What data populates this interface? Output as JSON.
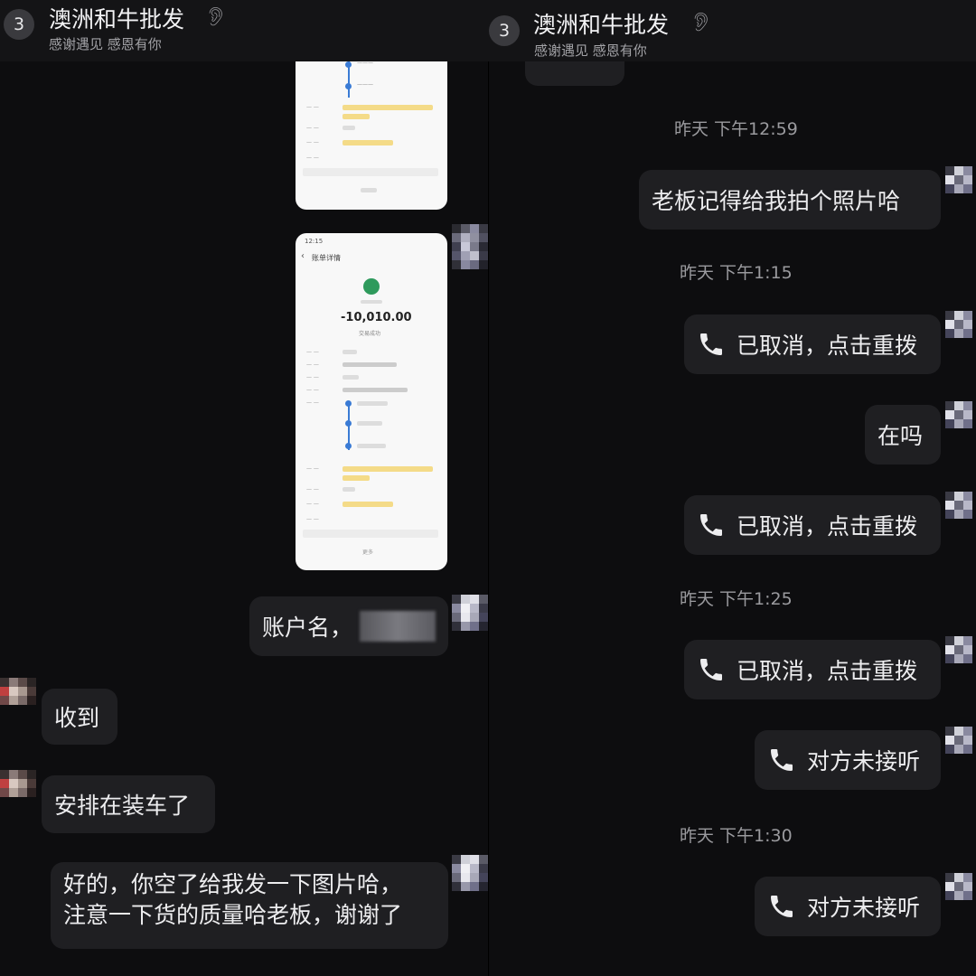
{
  "left_chat": {
    "header": {
      "unread": "3",
      "title": "澳洲和牛批发",
      "subtitle": "感谢遇见 感恩有你"
    },
    "receipt": {
      "status_time": "12:15",
      "page_title": "账单详情",
      "amount": "-10,010.00",
      "status": "交易成功",
      "footer": "更多"
    },
    "messages": {
      "account_name": "账户名，",
      "received": "收到",
      "loading": "安排在装车了",
      "request_line1": "好的，你空了给我发一下图片哈，",
      "request_line2": "注意一下货的质量哈老板，谢谢了"
    }
  },
  "right_chat": {
    "header": {
      "unread": "3",
      "title": "澳洲和牛批发",
      "subtitle": "感谢遇见 感恩有你"
    },
    "timestamps": [
      "昨天 下午12:59",
      "昨天 下午1:15",
      "昨天 下午1:25",
      "昨天 下午1:30"
    ],
    "messages": {
      "photo_request": "老板记得给我拍个照片哈",
      "cancelled_1": "已取消，点击重拨",
      "are_you_there": "在吗",
      "cancelled_2": "已取消，点击重拨",
      "cancelled_3": "已取消，点击重拨",
      "no_answer_1": "对方未接听",
      "no_answer_2": "对方未接听"
    }
  },
  "icons": {
    "phone": "phone-icon",
    "ear": "ear-icon",
    "bank": "bank-logo-icon",
    "back": "chevron-left-icon"
  },
  "colors": {
    "background": "#0d0d0f",
    "bubble": "#1f1f22",
    "accent_blue": "#3a7bd5"
  }
}
